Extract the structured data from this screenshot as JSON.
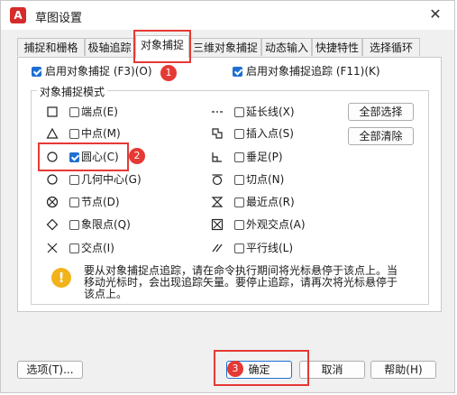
{
  "window": {
    "title": "草图设置",
    "app_icon": "A"
  },
  "tabs": [
    {
      "label": "捕捉和栅格"
    },
    {
      "label": "极轴追踪"
    },
    {
      "label": "对象捕捉"
    },
    {
      "label": "三维对象捕捉"
    },
    {
      "label": "动态输入"
    },
    {
      "label": "快捷特性"
    },
    {
      "label": "选择循环"
    }
  ],
  "top_options": {
    "osnap_on": {
      "label": "启用对象捕捉 (F3)(O)",
      "checked": true
    },
    "otrack_on": {
      "label": "启用对象捕捉追踪 (F11)(K)",
      "checked": true
    }
  },
  "group": {
    "legend": "对象捕捉模式"
  },
  "modes_left": [
    {
      "label": "端点(E)",
      "checked": false,
      "icon": "square-icon"
    },
    {
      "label": "中点(M)",
      "checked": false,
      "icon": "triangle-icon"
    },
    {
      "label": "圆心(C)",
      "checked": true,
      "icon": "circle-icon"
    },
    {
      "label": "几何中心(G)",
      "checked": false,
      "icon": "circle-icon"
    },
    {
      "label": "节点(D)",
      "checked": false,
      "icon": "node-icon"
    },
    {
      "label": "象限点(Q)",
      "checked": false,
      "icon": "diamond-icon"
    },
    {
      "label": "交点(I)",
      "checked": false,
      "icon": "x-icon"
    }
  ],
  "modes_right": [
    {
      "label": "延长线(X)",
      "checked": false,
      "icon": "extension-icon"
    },
    {
      "label": "插入点(S)",
      "checked": false,
      "icon": "insert-icon"
    },
    {
      "label": "垂足(P)",
      "checked": false,
      "icon": "perpendicular-icon"
    },
    {
      "label": "切点(N)",
      "checked": false,
      "icon": "tangent-icon"
    },
    {
      "label": "最近点(R)",
      "checked": false,
      "icon": "nearest-icon"
    },
    {
      "label": "外观交点(A)",
      "checked": false,
      "icon": "apparent-intersection-icon"
    },
    {
      "label": "平行线(L)",
      "checked": false,
      "icon": "parallel-icon"
    }
  ],
  "side_buttons": {
    "select_all": "全部选择",
    "clear_all": "全部清除"
  },
  "tip": "要从对象捕捉点追踪，请在命令执行期间将光标悬停于该点上。当移动光标时，会出现追踪矢量。要停止追踪，请再次将光标悬停于该点上。",
  "footer": {
    "options": "选项(T)...",
    "ok": "确定",
    "cancel": "取消",
    "help": "帮助(H)"
  },
  "badges": [
    "1",
    "2",
    "3"
  ],
  "colors": {
    "accent": "#1f6fd1",
    "highlight": "#e53935",
    "tip_icon": "#f2b21b"
  }
}
